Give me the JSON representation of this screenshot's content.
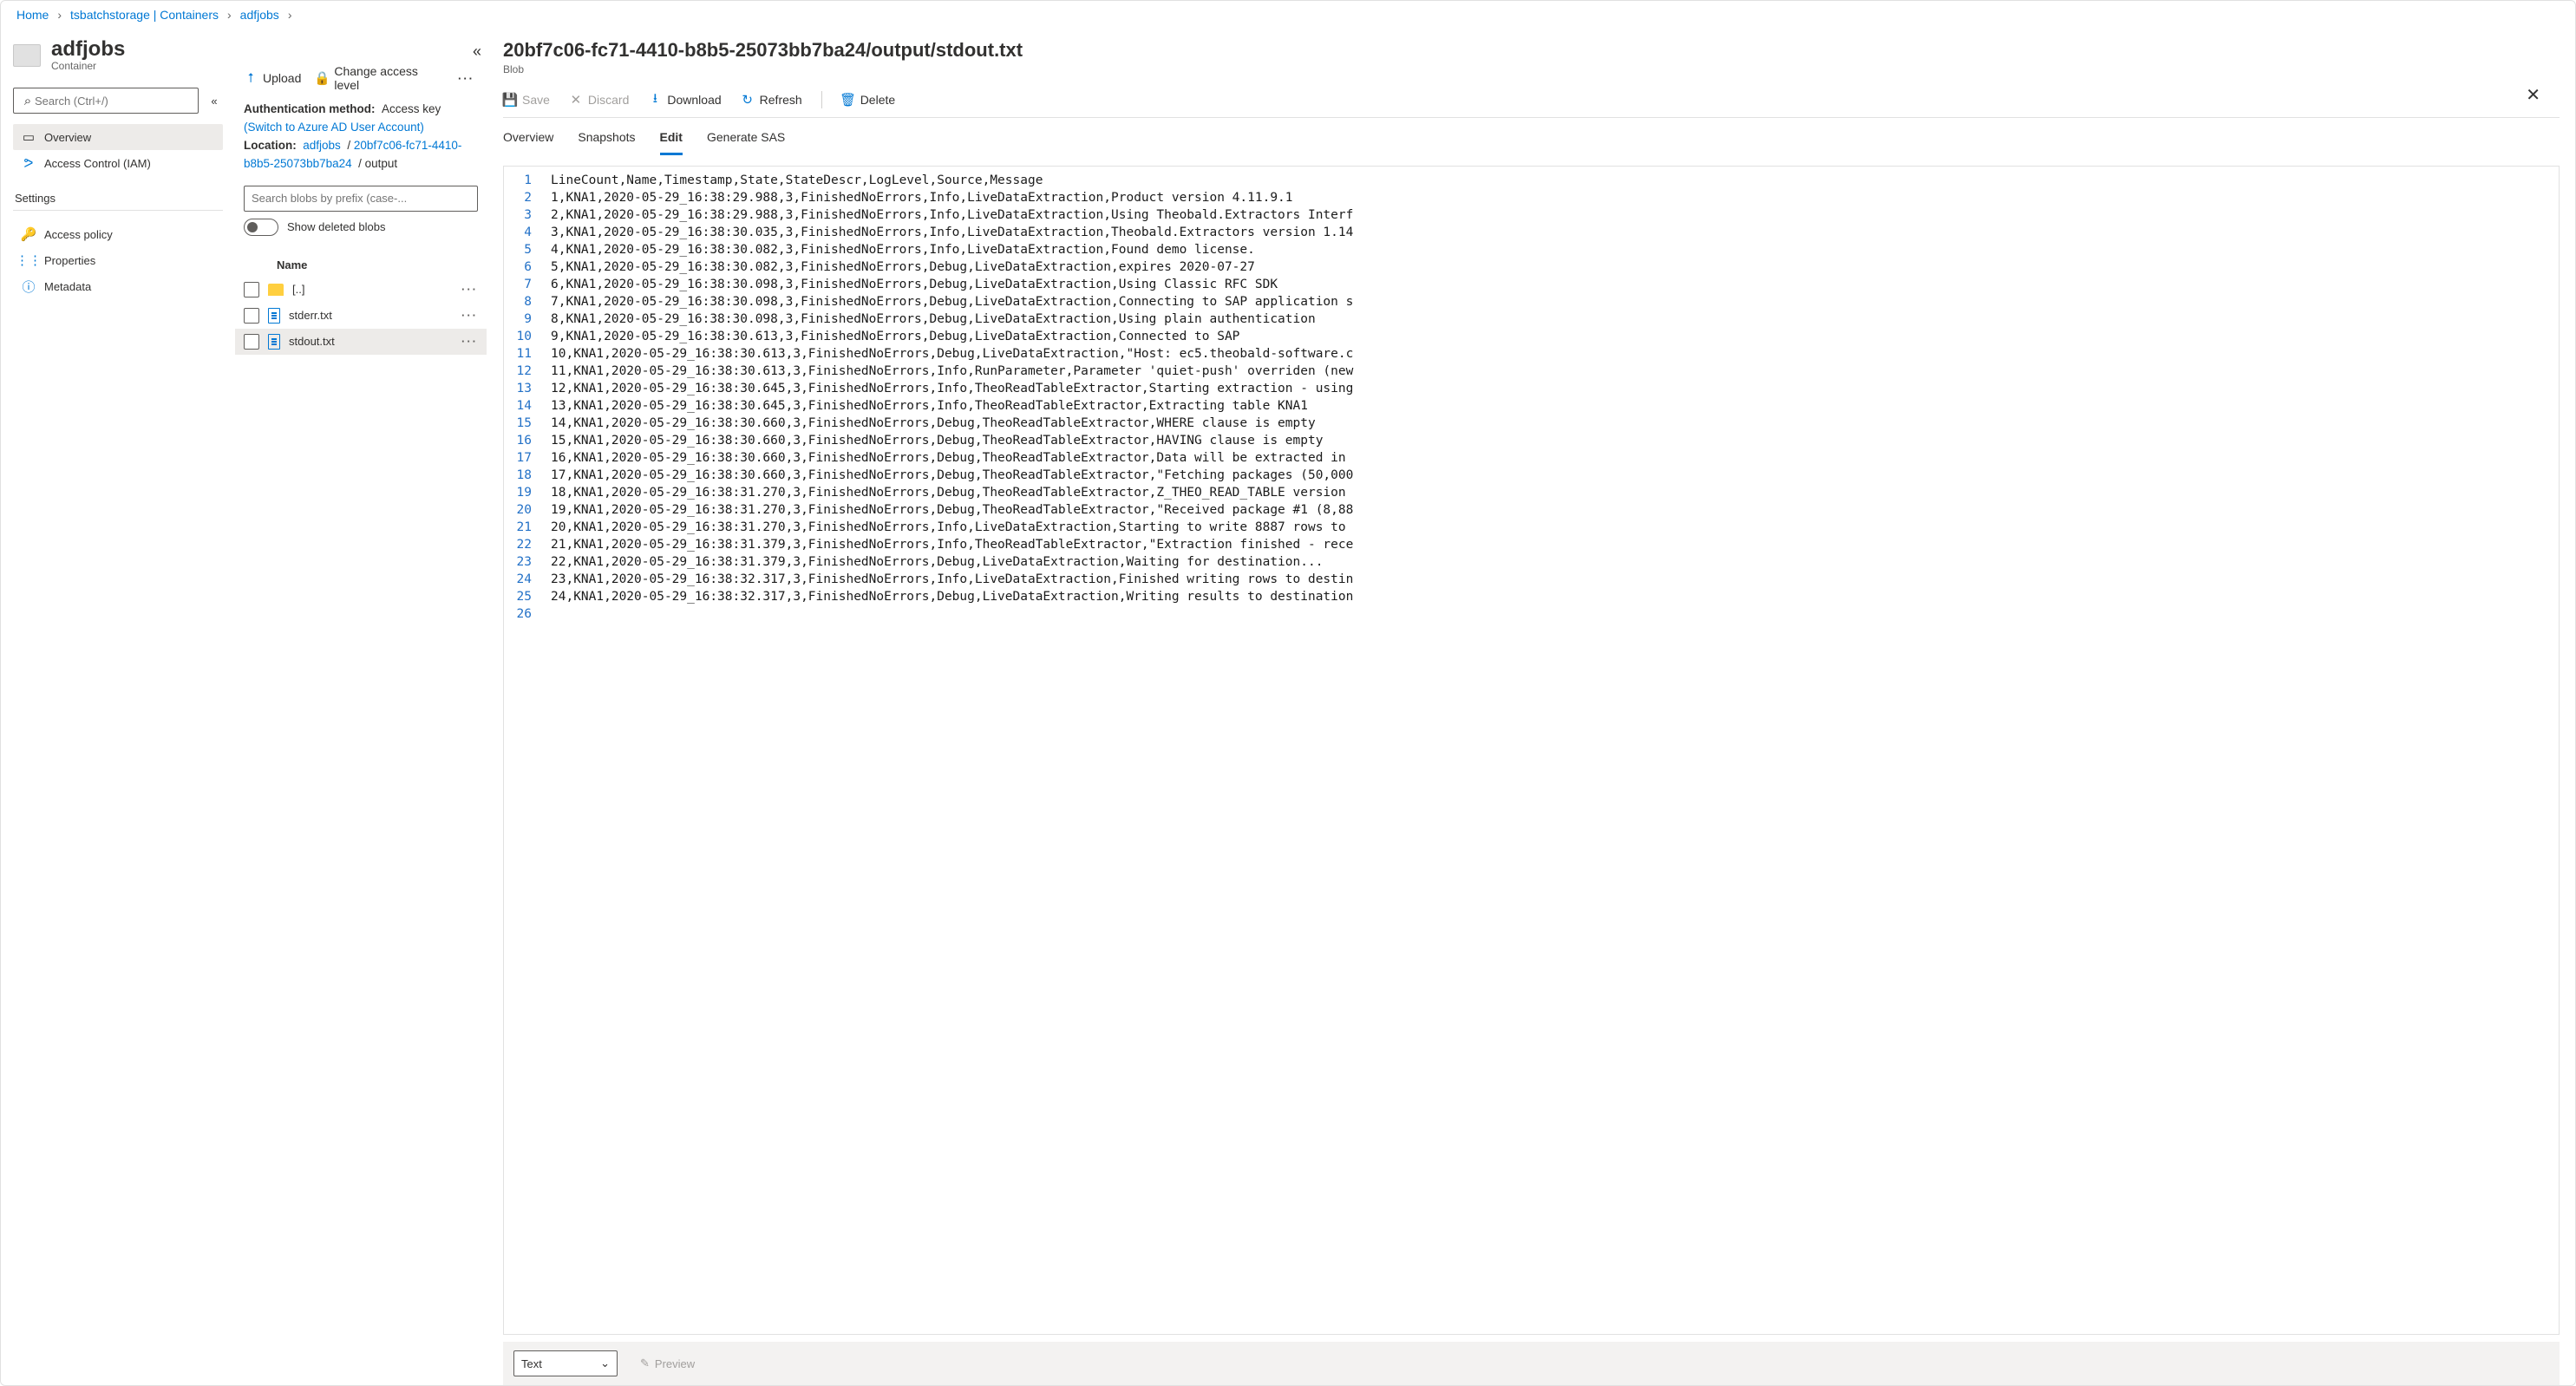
{
  "breadcrumb": {
    "home": "Home",
    "storage": "tsbatchstorage | Containers",
    "container": "adfjobs"
  },
  "left": {
    "title": "adfjobs",
    "subtitle": "Container",
    "search_placeholder": "Search (Ctrl+/)",
    "nav": {
      "overview": "Overview",
      "iam": "Access Control (IAM)"
    },
    "settings_label": "Settings",
    "settings": {
      "access_policy": "Access policy",
      "properties": "Properties",
      "metadata": "Metadata"
    }
  },
  "mid": {
    "upload": "Upload",
    "change_access": "Change access level",
    "auth_label": "Authentication method:",
    "auth_value": "Access key",
    "auth_switch": "(Switch to Azure AD User Account)",
    "location_label": "Location:",
    "loc_adfjobs": "adfjobs",
    "loc_guid": "20bf7c06-fc71-4410-b8b5-25073bb7ba24",
    "loc_output": "output",
    "search_placeholder": "Search blobs by prefix (case-...",
    "toggle_label": "Show deleted blobs",
    "col_name": "Name",
    "rows": {
      "up": "[..]",
      "stderr": "stderr.txt",
      "stdout": "stdout.txt"
    }
  },
  "right": {
    "title": "20bf7c06-fc71-4410-b8b5-25073bb7ba24/output/stdout.txt",
    "subtitle": "Blob",
    "toolbar": {
      "save": "Save",
      "discard": "Discard",
      "download": "Download",
      "refresh": "Refresh",
      "delete": "Delete"
    },
    "tabs": {
      "overview": "Overview",
      "snapshots": "Snapshots",
      "edit": "Edit",
      "sas": "Generate SAS"
    },
    "footer": {
      "format": "Text",
      "preview": "Preview"
    },
    "lines": [
      "LineCount,Name,Timestamp,State,StateDescr,LogLevel,Source,Message",
      "1,KNA1,2020-05-29_16:38:29.988,3,FinishedNoErrors,Info,LiveDataExtraction,Product version 4.11.9.1",
      "2,KNA1,2020-05-29_16:38:29.988,3,FinishedNoErrors,Info,LiveDataExtraction,Using Theobald.Extractors Interf",
      "3,KNA1,2020-05-29_16:38:30.035,3,FinishedNoErrors,Info,LiveDataExtraction,Theobald.Extractors version 1.14",
      "4,KNA1,2020-05-29_16:38:30.082,3,FinishedNoErrors,Info,LiveDataExtraction,Found demo license.",
      "5,KNA1,2020-05-29_16:38:30.082,3,FinishedNoErrors,Debug,LiveDataExtraction,expires 2020-07-27",
      "6,KNA1,2020-05-29_16:38:30.098,3,FinishedNoErrors,Debug,LiveDataExtraction,Using Classic RFC SDK",
      "7,KNA1,2020-05-29_16:38:30.098,3,FinishedNoErrors,Debug,LiveDataExtraction,Connecting to SAP application s",
      "8,KNA1,2020-05-29_16:38:30.098,3,FinishedNoErrors,Debug,LiveDataExtraction,Using plain authentication",
      "9,KNA1,2020-05-29_16:38:30.613,3,FinishedNoErrors,Debug,LiveDataExtraction,Connected to SAP",
      "10,KNA1,2020-05-29_16:38:30.613,3,FinishedNoErrors,Debug,LiveDataExtraction,\"Host: ec5.theobald-software.c",
      "11,KNA1,2020-05-29_16:38:30.613,3,FinishedNoErrors,Info,RunParameter,Parameter 'quiet-push' overriden (new",
      "12,KNA1,2020-05-29_16:38:30.645,3,FinishedNoErrors,Info,TheoReadTableExtractor,Starting extraction - using",
      "13,KNA1,2020-05-29_16:38:30.645,3,FinishedNoErrors,Info,TheoReadTableExtractor,Extracting table KNA1",
      "14,KNA1,2020-05-29_16:38:30.660,3,FinishedNoErrors,Debug,TheoReadTableExtractor,WHERE clause is empty",
      "15,KNA1,2020-05-29_16:38:30.660,3,FinishedNoErrors,Debug,TheoReadTableExtractor,HAVING clause is empty",
      "16,KNA1,2020-05-29_16:38:30.660,3,FinishedNoErrors,Debug,TheoReadTableExtractor,Data will be extracted in ",
      "17,KNA1,2020-05-29_16:38:30.660,3,FinishedNoErrors,Debug,TheoReadTableExtractor,\"Fetching packages (50,000",
      "18,KNA1,2020-05-29_16:38:31.270,3,FinishedNoErrors,Debug,TheoReadTableExtractor,Z_THEO_READ_TABLE version ",
      "19,KNA1,2020-05-29_16:38:31.270,3,FinishedNoErrors,Debug,TheoReadTableExtractor,\"Received package #1 (8,88",
      "20,KNA1,2020-05-29_16:38:31.270,3,FinishedNoErrors,Info,LiveDataExtraction,Starting to write 8887 rows to ",
      "21,KNA1,2020-05-29_16:38:31.379,3,FinishedNoErrors,Info,TheoReadTableExtractor,\"Extraction finished - rece",
      "22,KNA1,2020-05-29_16:38:31.379,3,FinishedNoErrors,Debug,LiveDataExtraction,Waiting for destination...",
      "23,KNA1,2020-05-29_16:38:32.317,3,FinishedNoErrors,Info,LiveDataExtraction,Finished writing rows to destin",
      "24,KNA1,2020-05-29_16:38:32.317,3,FinishedNoErrors,Debug,LiveDataExtraction,Writing results to destination",
      ""
    ]
  }
}
